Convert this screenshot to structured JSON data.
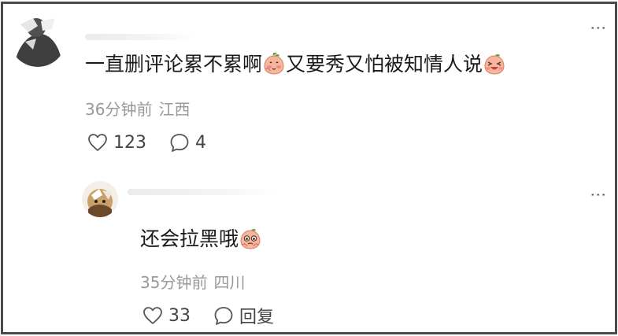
{
  "comments": [
    {
      "text_before": "一直删评论累不累啊",
      "text_middle": "又要秀又怕被知情人说",
      "emoji_1": "peach-blush-emoji",
      "emoji_2": "peach-laugh-emoji",
      "time": "36分钟前",
      "location": "江西",
      "likes": "123",
      "replies": "4",
      "more": "⋮"
    },
    {
      "text": "还会拉黑哦",
      "emoji": "peach-crying-emoji",
      "time": "35分钟前",
      "location": "四川",
      "likes": "33",
      "reply_label": "回复",
      "more": "⋮"
    }
  ],
  "colors": {
    "frame": "#4a4a4a",
    "meta": "#999999",
    "text": "#1a1a1a",
    "peach": "#f6b59c"
  }
}
